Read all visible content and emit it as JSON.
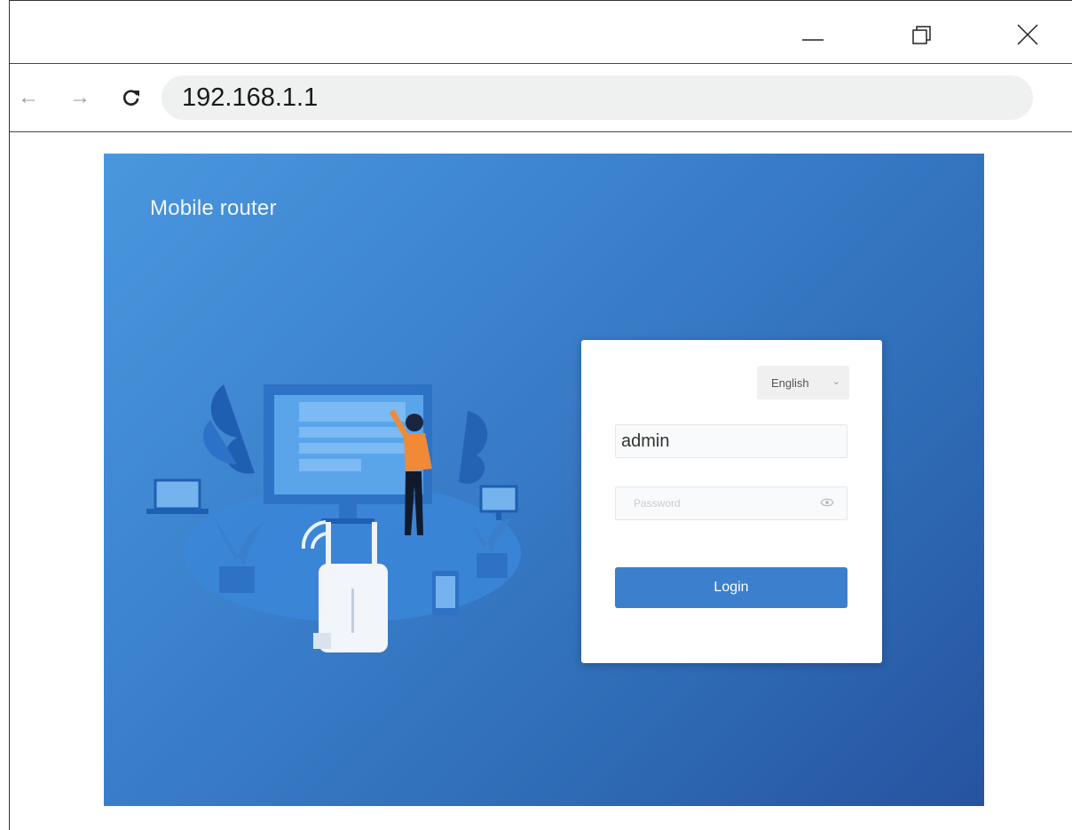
{
  "browser": {
    "url": "192.168.1.1",
    "icons": {
      "back": "arrow-left-icon",
      "forward": "arrow-right-icon",
      "reload": "reload-icon",
      "minimize": "minimize-icon",
      "maximize": "restore-icon",
      "close": "close-icon"
    }
  },
  "page": {
    "brand": "Mobile router",
    "colors": {
      "background_start": "#4a97de",
      "background_end": "#2653a0",
      "button": "#3c7fcc"
    },
    "login": {
      "language": "English",
      "username_value": "admin",
      "password_placeholder": "Password",
      "login_label": "Login"
    }
  }
}
